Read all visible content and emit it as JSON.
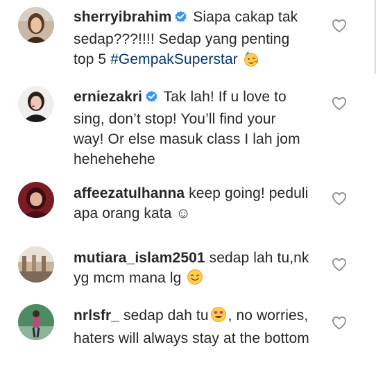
{
  "comments": [
    {
      "username": "sherryibrahim",
      "verified": true,
      "text_before_hashtag": "Siapa cakap tak sedap???!!!! Sedap yang penting top 5 ",
      "hashtag": "#GempakSuperstar",
      "emoji": "partying-face",
      "avatar": "woman-profile-photo"
    },
    {
      "username": "erniezakri",
      "verified": true,
      "text": "Tak lah! If u love to sing, don’t stop! You’ll find your way! Or else masuk class I lah jom hehehehehe",
      "avatar": "woman-profile-photo"
    },
    {
      "username": "affeezatulhanna",
      "verified": false,
      "text": "keep going! peduli apa orang kata ☺",
      "avatar": "woman-hijab-profile-photo"
    },
    {
      "username": "mutiara_islam2501",
      "verified": false,
      "text": "sedap lah tu,nk yg mcm mana lg",
      "emoji": "smiling-face",
      "avatar": "group-profile-photo"
    },
    {
      "username": "nrlsfr_",
      "verified": false,
      "text_before_emoji": "sedap dah tu",
      "text_after_emoji": ", no worries, haters will always stay at the bottom",
      "emoji": "heart-eyes-face",
      "avatar": "person-standing-profile-photo"
    }
  ],
  "colors": {
    "text": "#262626",
    "verified": "#3897f0",
    "hashtag": "#00376b",
    "heart_outline": "#8e8e8e"
  },
  "icons": {
    "like": "heart-outline-icon",
    "verified": "verified-badge-icon"
  }
}
